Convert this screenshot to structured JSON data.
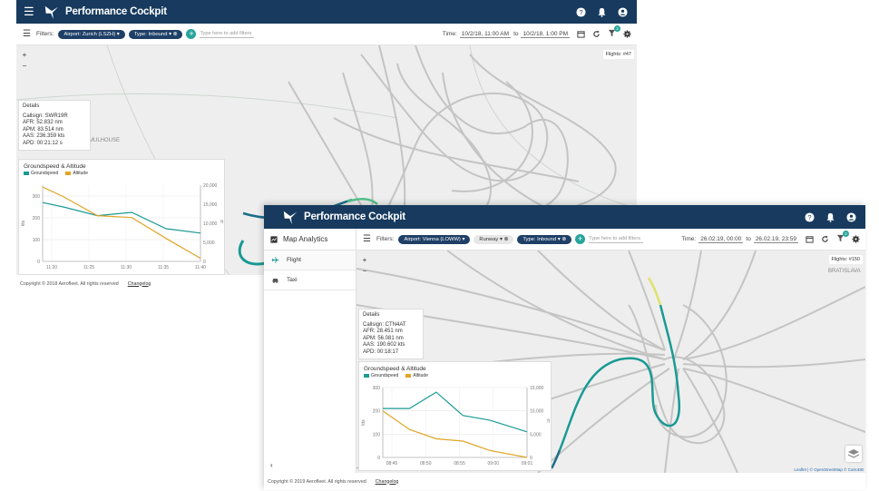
{
  "app": {
    "title": "Performance Cockpit"
  },
  "window1": {
    "filters_label": "Filters:",
    "chips": [
      "Airport: Zurich (LSZH)",
      "Type: Inbound"
    ],
    "add_placeholder": "Type here to add filters",
    "time_label": "Time:",
    "time_from": "10/2/18, 11:00 AM",
    "time_to_word": "to",
    "time_to": "10/2/18, 1:00 PM",
    "flights": "Flights: #47",
    "details": {
      "title": "Details",
      "callsign": "Callsign: SWR19R",
      "afr": "AFR: 52.832 nm",
      "apm": "APM: 83.514 nm",
      "aas": "AAS: 236.359 kts",
      "apd": "APD: 00:21:12 s"
    },
    "chart_title": "Groundspeed & Altitude",
    "footer_copy": "Copyright © 2018 Aerofleet. All rights reserved",
    "footer_link": "Changelog",
    "map_labels": [
      "MULHOUSE"
    ]
  },
  "window2": {
    "sidebar": {
      "title": "Map Analytics",
      "items": [
        "Flight",
        "Taxi"
      ],
      "collapse": "‹"
    },
    "filters_label": "Filters:",
    "chips": [
      "Airport: Vienna (LOWW)",
      "Runway",
      "Type: Inbound"
    ],
    "add_placeholder": "Type here to add filters",
    "time_label": "Time:",
    "time_from": "26.02.19, 00:00",
    "time_to_word": "to",
    "time_to": "26.02.19, 23:59",
    "flights": "Flights: #150",
    "details": {
      "title": "Details",
      "callsign": "Callsign: CTN4AT",
      "afr": "AFR: 28.451 nm",
      "apm": "APM: 56.081 nm",
      "aas": "AAS: 190.602 kts",
      "apd": "APD: 00:18:17"
    },
    "chart_title": "Groundspeed & Altitude",
    "footer_copy": "Copyright © 2019 Aerofleet. All rights reserved",
    "footer_link": "Changelog",
    "attribution": "Leaflet | © OpenStreetMap © CartoDB",
    "map_labels": [
      "BRATISLAVA"
    ]
  },
  "colors": {
    "appbar": "#173a5e",
    "groundspeed": "#1a9a94",
    "altitude": "#e0a526",
    "chip": "#1e3f66",
    "track": "#bdbdbd"
  },
  "chart_data": [
    {
      "type": "line",
      "title": "Groundspeed & Altitude",
      "series": [
        {
          "name": "Groundspeed",
          "x": [
            11.17,
            11.2,
            11.25,
            11.3,
            11.35,
            11.4
          ],
          "values": [
            270,
            250,
            210,
            225,
            150,
            130
          ]
        },
        {
          "name": "Altitude",
          "x": [
            11.17,
            11.2,
            11.25,
            11.3,
            11.35,
            11.4
          ],
          "values": [
            19500,
            17000,
            12000,
            11500,
            6000,
            800
          ]
        }
      ],
      "x_ticks": [
        "11:20",
        "11:25",
        "11:30",
        "11:35",
        "11:40"
      ],
      "y_left_ticks": [
        "0",
        "100",
        "200",
        "300"
      ],
      "y_right_ticks": [
        "0",
        "5,000",
        "10,000",
        "15,000",
        "20,000"
      ],
      "ylabel": "kts",
      "y2label": "ft",
      "ylim": [
        0,
        350
      ],
      "y2lim": [
        0,
        20000
      ],
      "legend": [
        "Groundspeed",
        "Altitude"
      ]
    },
    {
      "type": "line",
      "title": "Groundspeed & Altitude",
      "series": [
        {
          "name": "Groundspeed",
          "x": [
            8.73,
            8.78,
            8.83,
            8.88,
            8.93,
            9.0
          ],
          "values": [
            210,
            210,
            280,
            180,
            160,
            110
          ]
        },
        {
          "name": "Altitude",
          "x": [
            8.73,
            8.78,
            8.83,
            8.88,
            8.93,
            9.0
          ],
          "values": [
            10000,
            6000,
            4000,
            3500,
            1500,
            0
          ]
        }
      ],
      "x_ticks": [
        "08:45",
        "08:50",
        "08:55",
        "09:00",
        "09:01"
      ],
      "y_left_ticks": [
        "0",
        "100",
        "200",
        "300"
      ],
      "y_right_ticks": [
        "0",
        "5,000",
        "10,000",
        "15,000"
      ],
      "ylabel": "kts",
      "y2label": "ft",
      "ylim": [
        0,
        300
      ],
      "y2lim": [
        0,
        15000
      ],
      "legend": [
        "Groundspeed",
        "Altitude"
      ]
    }
  ]
}
